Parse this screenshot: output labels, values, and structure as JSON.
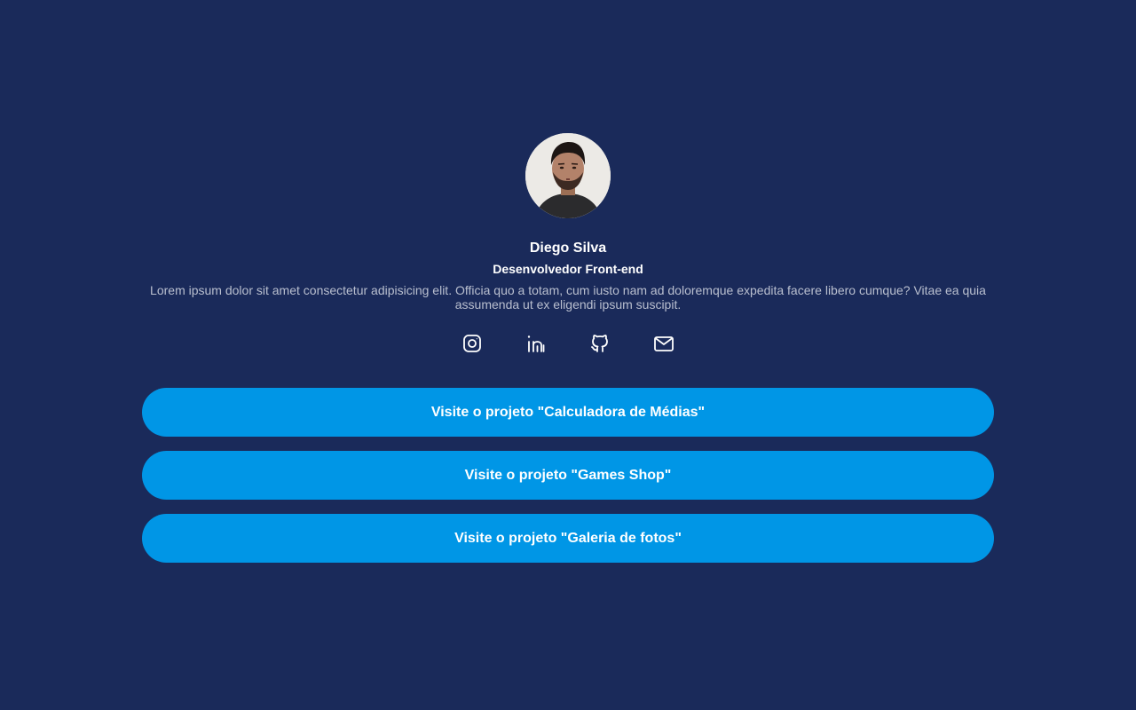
{
  "profile": {
    "name": "Diego Silva",
    "role": "Desenvolvedor Front-end",
    "bio": "Lorem ipsum dolor sit amet consectetur adipisicing elit. Officia quo a totam, cum iusto nam ad doloremque expedita facere libero cumque? Vitae ea quia assumenda ut ex eligendi ipsum suscipit."
  },
  "social": [
    {
      "icon": "instagram-icon"
    },
    {
      "icon": "linkedin-icon"
    },
    {
      "icon": "github-icon"
    },
    {
      "icon": "email-icon"
    }
  ],
  "links": [
    {
      "label": "Visite o projeto \"Calculadora de Médias\""
    },
    {
      "label": "Visite o projeto \"Games Shop\""
    },
    {
      "label": "Visite o projeto \"Galeria de fotos\""
    }
  ],
  "colors": {
    "background": "#1a2a5a",
    "button": "#0096e6",
    "text": "#ffffff",
    "muted_text": "#b9bfcf"
  }
}
